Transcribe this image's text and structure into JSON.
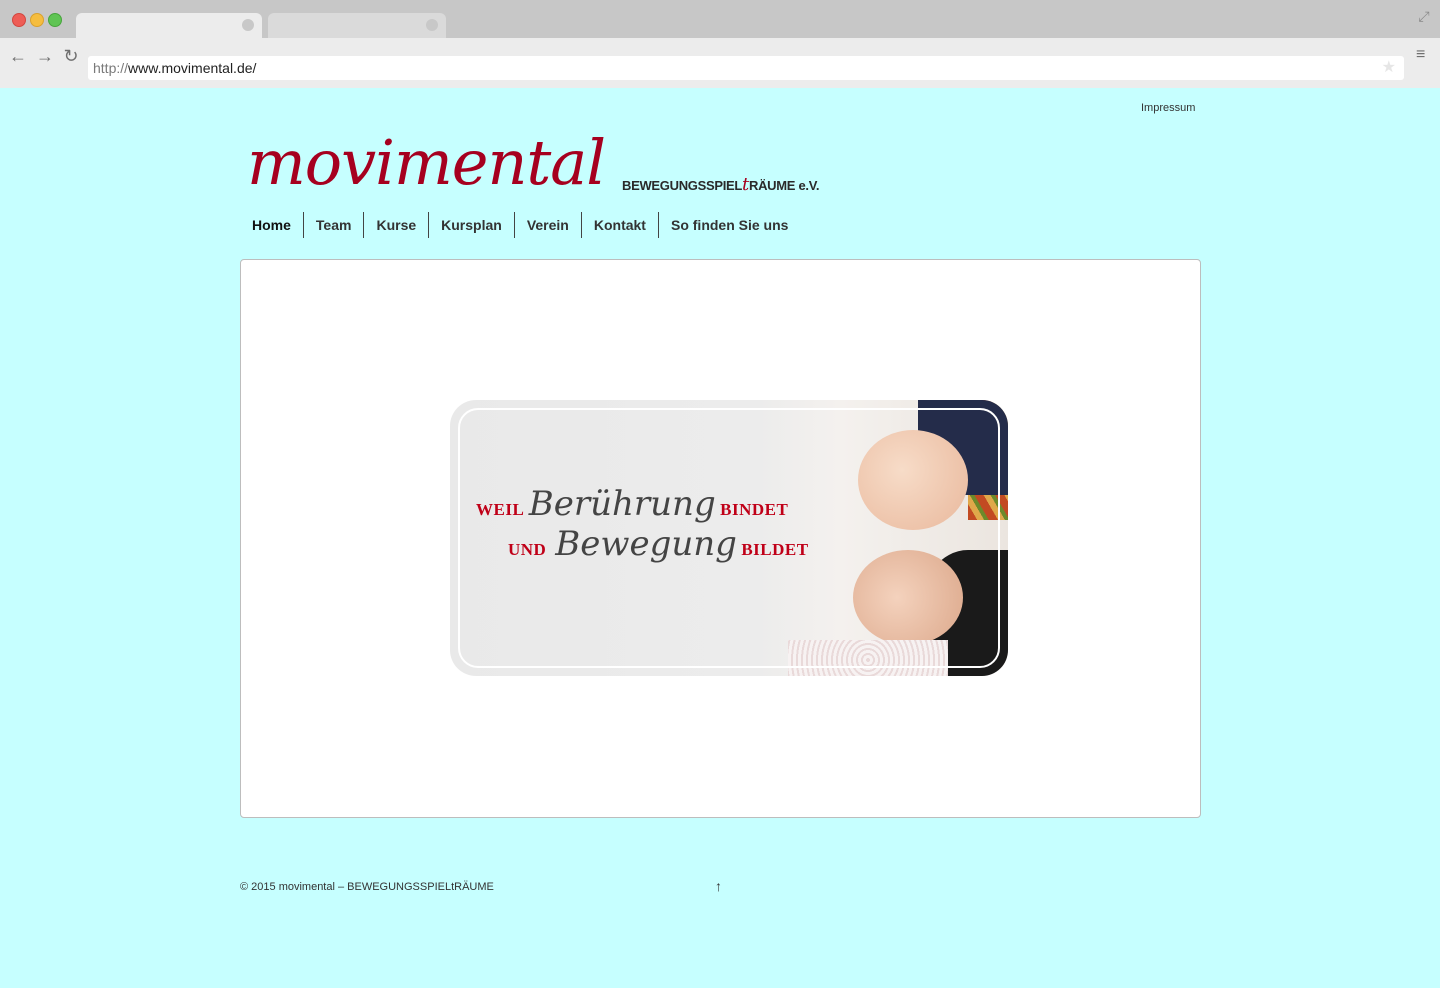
{
  "browser": {
    "url_protocol": "http://",
    "url_host": "www.movimental.de/"
  },
  "header": {
    "impressum_link": "Impressum",
    "logo_word": "movimental",
    "logo_sub_part1": "BEWEGUNGSSPIEL",
    "logo_sub_t": "t",
    "logo_sub_part2": "RÄUME e.V."
  },
  "nav": {
    "items": [
      {
        "label": "Home"
      },
      {
        "label": "Team"
      },
      {
        "label": "Kurse"
      },
      {
        "label": "Kursplan"
      },
      {
        "label": "Verein"
      },
      {
        "label": "Kontakt"
      },
      {
        "label": "So finden Sie uns"
      }
    ]
  },
  "hero": {
    "line1_caps_a": "WEIL",
    "line1_script": "Berührung",
    "line1_caps_b": "BINDET",
    "line2_caps_a": "UND",
    "line2_script": "Bewegung",
    "line2_caps_b": "BILDET"
  },
  "footer": {
    "copyright": "© 2015 movimental – BEWEGUNGSSPIELtRÄUME",
    "to_top": "↑"
  },
  "colors": {
    "page_bg": "#c6ffff",
    "brand_red": "#a6001f"
  }
}
